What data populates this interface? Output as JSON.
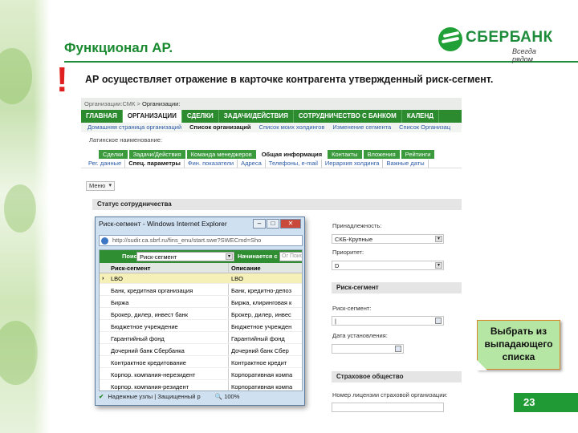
{
  "slide": {
    "title": "Функционал  АР.",
    "exclamation": "!",
    "statement": "АР осуществляет отражение в карточке контрагента утвержденный риск-сегмент.",
    "page_number": "23"
  },
  "logo": {
    "name": "СБЕРБАНК",
    "slogan": "Всегда рядом"
  },
  "app": {
    "breadcrumb": [
      "Организации:СМК",
      ">",
      "Организации:"
    ],
    "main_nav": [
      {
        "label": "ГЛАВНАЯ",
        "active": false
      },
      {
        "label": "ОРГАНИЗАЦИИ",
        "active": true
      },
      {
        "label": "СДЕЛКИ",
        "active": false
      },
      {
        "label": "ЗАДАЧИ/ДЕЙСТВИЯ",
        "active": false
      },
      {
        "label": "СОТРУДНИЧЕСТВО С БАНКОМ",
        "active": false
      },
      {
        "label": "КАЛЕНД",
        "active": false
      }
    ],
    "sub_nav": [
      {
        "label": "Домашняя страница организаций",
        "active": false
      },
      {
        "label": "Список организаций",
        "active": true
      },
      {
        "label": "Список моих холдингов",
        "active": false
      },
      {
        "label": "Изменение сегмента",
        "active": false
      },
      {
        "label": "Список Организац",
        "active": false
      }
    ],
    "latin_label": "Латинское наименование:",
    "tabs": [
      {
        "label": "Сделки",
        "active": false
      },
      {
        "label": "Задачи/Действия",
        "active": false
      },
      {
        "label": "Команда менеджеров",
        "active": false
      },
      {
        "label": "Общая информация",
        "active": true
      },
      {
        "label": "Контакты",
        "active": false
      },
      {
        "label": "Вложения",
        "active": false
      },
      {
        "label": "Рейтинги",
        "active": false
      }
    ],
    "subtabs": [
      {
        "label": "Рег. данные",
        "active": false
      },
      {
        "label": "Спец. параметры",
        "active": true
      },
      {
        "label": "Фин. показатели",
        "active": false
      },
      {
        "label": "Адреса",
        "active": false
      },
      {
        "label": "Телефоны, e-mail",
        "active": false
      },
      {
        "label": "Иерархия холдинга",
        "active": false
      },
      {
        "label": "Важные даты",
        "active": false
      }
    ],
    "menu_button": "Меню",
    "section_status": "Статус сотрудничества",
    "belonging_label": "Принадлежность:",
    "belonging_value": "СКБ-Крупные",
    "priority_label": "Приоритет:",
    "priority_value": "D",
    "section_risk": "Риск-сегмент",
    "risk_label": "Риск-сегмент:",
    "date_label": "Дата установления:",
    "section_insurance": "Страховое общество",
    "license_label": "Номер лицензии страховой организации:"
  },
  "popup": {
    "title": "Риск-сегмент - Windows Internet Explorer",
    "url": "http://sudir.ca.sbrf.ru/fins_enu/start.swe?SWECmd=Sho",
    "search_label": "Поиск",
    "search_field": "Риск-сегмент",
    "search_mode": "Начинается с",
    "search_placeholder": "Ог Поиск",
    "col_name": "Риск-сегмент",
    "col_desc": "Описание",
    "rows": [
      {
        "name": "LBO",
        "desc": "LBO",
        "selected": true
      },
      {
        "name": "Банк, кредитная организация",
        "desc": "Банк, кредитно-депоз",
        "selected": false
      },
      {
        "name": "Биржа",
        "desc": "Биржа, клиринговая к",
        "selected": false
      },
      {
        "name": "Брокер, дилер, инвест банк",
        "desc": "Брокер, дилер, инвес",
        "selected": false
      },
      {
        "name": "Бюджетное учреждение",
        "desc": "Бюджетное учрежден",
        "selected": false
      },
      {
        "name": "Гарантийный фонд",
        "desc": "Гарантийный фонд",
        "selected": false
      },
      {
        "name": "Дочерний банк Сбербанка",
        "desc": "Дочерний банк Сбер",
        "selected": false
      },
      {
        "name": "Контрактное кредитование",
        "desc": "Контрактное кредит",
        "selected": false
      },
      {
        "name": "Корпор. компания-нерезидент",
        "desc": "Корпоративная компа",
        "selected": false
      },
      {
        "name": "Корпор. компания-резидент",
        "desc": "Корпоративная компа",
        "selected": false
      }
    ],
    "status_text": "Надежные узлы | Защищенный р",
    "zoom": "100%"
  },
  "callout": {
    "text": "Выбрать из выпадающего списка"
  },
  "colors": {
    "brand_green": "#1f8c3b",
    "nav_green": "#2c8a2f",
    "alert_red": "#e02020",
    "callout_fill": "#b6e6a4"
  }
}
